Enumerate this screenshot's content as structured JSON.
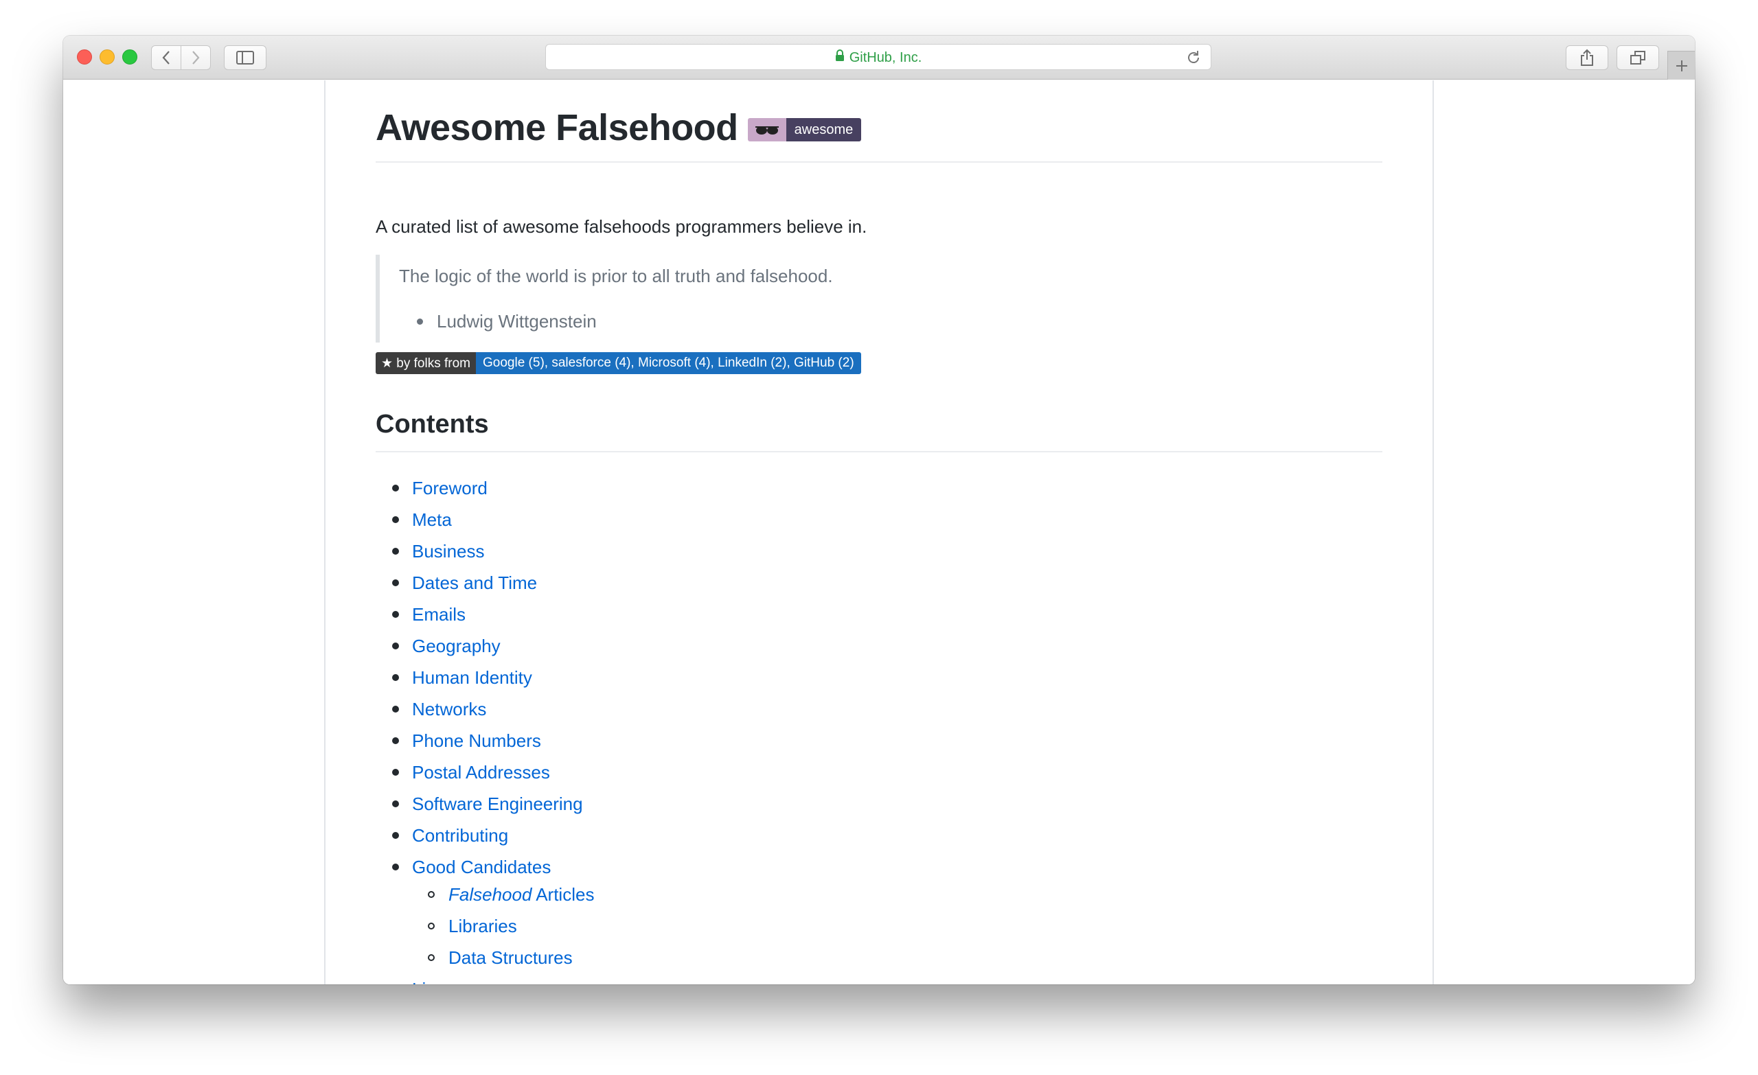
{
  "browser": {
    "address_text": "GitHub, Inc.",
    "accent_secure": "#2f9f48"
  },
  "page": {
    "title": "Awesome Falsehood",
    "awesome_badge": "awesome",
    "description": "A curated list of awesome falsehoods programmers believe in.",
    "quote": {
      "text": "The logic of the world is prior to all truth and falsehood.",
      "author": "Ludwig Wittgenstein"
    },
    "folks_badge": {
      "left": "★ by folks from",
      "right": "Google (5), salesforce (4), Microsoft (4), LinkedIn (2), GitHub (2)"
    },
    "contents_heading": "Contents",
    "toc": [
      "Foreword",
      "Meta",
      "Business",
      "Dates and Time",
      "Emails",
      "Geography",
      "Human Identity",
      "Networks",
      "Phone Numbers",
      "Postal Addresses",
      "Software Engineering",
      "Contributing",
      "Good Candidates"
    ],
    "toc_sub": {
      "articles_em": "Falsehood",
      "articles_rest": " Articles",
      "libraries": "Libraries",
      "data_structures": "Data Structures"
    },
    "toc_last": "License",
    "link_color": "#0366d6"
  }
}
